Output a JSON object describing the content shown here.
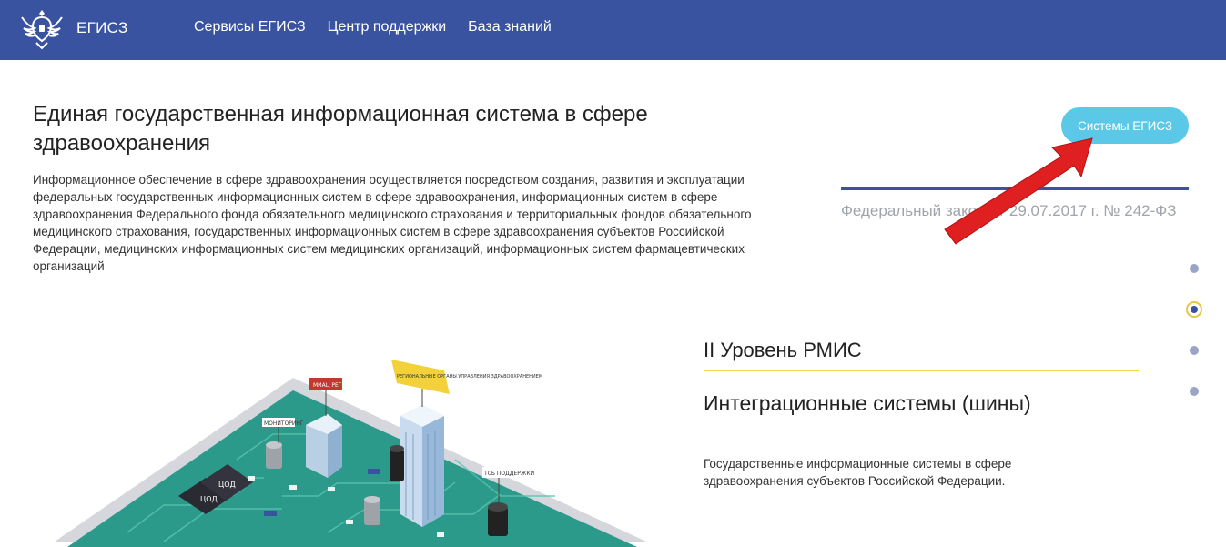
{
  "header": {
    "brand": "ЕГИСЗ",
    "nav": [
      "Сервисы ЕГИСЗ",
      "Центр поддержки",
      "База знаний"
    ]
  },
  "main": {
    "title": "Единая государственная информационная система в сфере здравоохранения",
    "description": "Информационное обеспечение в сфере здравоохранения осуществляется посредством создания, развития и эксплуатации федеральных государственных информационных систем в сфере здравоохранения, информационных систем в сфере здравоохранения Федерального фонда обязательного медицинского страхования и территориальных фондов обязательного медицинского страхования, государственных информационных систем в сфере здравоохранения субъектов Российской Федерации, медицинских информационных систем медицинских организаций, информационных систем фармацевтических организаций"
  },
  "aside": {
    "button_label": "Системы ЕГИСЗ",
    "law_text": "Федеральный закон от 29.07.2017 г. № 242-ФЗ"
  },
  "section": {
    "level_title": "II Уровень РМИС",
    "integration_title": "Интеграционные системы (шины)",
    "integration_desc": "Государственные информационные системы в сфере здравоохранения субъектов Российской Федерации."
  },
  "pagination": {
    "count": 4,
    "active_index": 1
  },
  "illustration": {
    "labels": [
      "ЦОД",
      "ЦОД",
      "ТСБ ПОДДЕРЖКИ",
      "МОНИТОРИНГ",
      "РЕГИОНАЛЬНЫЕ ОРГАНЫ УПРАВЛЕНИЯ ЗДРАВООХРАНЕНИЕМ",
      "МИАЦ РЕГИОНА"
    ]
  },
  "colors": {
    "header_bg": "#3a53a0",
    "button_bg": "#5ac8e6",
    "accent_yellow": "#f0d74a",
    "arrow_red": "#e02020"
  }
}
